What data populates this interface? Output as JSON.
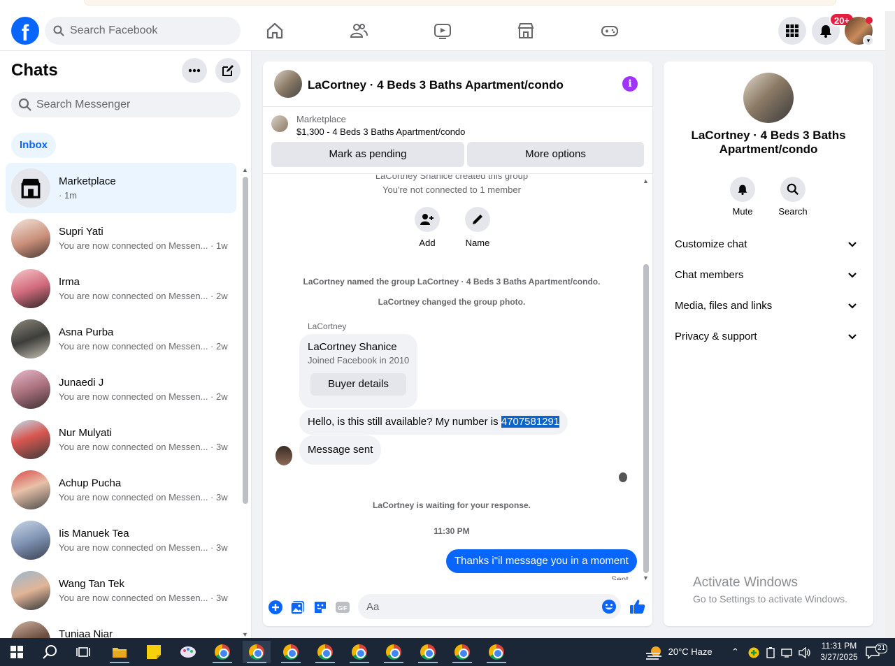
{
  "topnav": {
    "search_placeholder": "Search Facebook",
    "notification_badge": "20+"
  },
  "sidebar": {
    "title": "Chats",
    "search_placeholder": "Search Messenger",
    "filter_label": "Inbox",
    "conversations": [
      {
        "name": "Marketplace",
        "preview": "· 1m"
      },
      {
        "name": "Supri Yati",
        "preview": "You are now connected on Messen... · 1w"
      },
      {
        "name": "Irma",
        "preview": "You are now connected on Messen... · 2w"
      },
      {
        "name": "Asna Purba",
        "preview": "You are now connected on Messen... · 2w"
      },
      {
        "name": "Junaedi J",
        "preview": "You are now connected on Messen... · 2w"
      },
      {
        "name": "Nur Mulyati",
        "preview": "You are now connected on Messen... · 3w"
      },
      {
        "name": "Achup Pucha",
        "preview": "You are now connected on Messen... · 3w"
      },
      {
        "name": "Iis Manuek Tea",
        "preview": "You are now connected on Messen... · 3w"
      },
      {
        "name": "Wang Tan Tek",
        "preview": "You are now connected on Messen... · 3w"
      },
      {
        "name": "Tuniaa Niar",
        "preview": ""
      }
    ]
  },
  "chat": {
    "title": "LaCortney · 4 Beds 3 Baths Apartment/condo",
    "banner": {
      "label": "Marketplace",
      "listing": "$1,300 - 4 Beds 3 Baths Apartment/condo",
      "mark_pending": "Mark as pending",
      "more_options": "More options"
    },
    "system": {
      "created": "LaCortney Shanice created this group",
      "not_connected": "You're not connected to 1 member",
      "named": "LaCortney named the group LaCortney · 4 Beds 3 Baths Apartment/condo.",
      "changed_photo": "LaCortney changed the group photo.",
      "waiting": "LaCortney is waiting for your response.",
      "time": "11:30 PM"
    },
    "actions": {
      "add": "Add",
      "name": "Name"
    },
    "sender_label": "LaCortney",
    "profile_card": {
      "name": "LaCortney Shanice",
      "joined": "Joined Facebook in 2010",
      "button": "Buyer details"
    },
    "messages": {
      "incoming_1_text": "Hello, is this still available? My number is ",
      "incoming_1_highlight": "4707581291",
      "incoming_2": "Message sent",
      "outgoing": "Thanks i\"il message you in a moment",
      "status": "Sent"
    },
    "composer_placeholder": "Aa"
  },
  "details": {
    "title": "LaCortney · 4 Beds 3 Baths Apartment/condo",
    "mute": "Mute",
    "search": "Search",
    "sections": [
      "Customize chat",
      "Chat members",
      "Media, files and links",
      "Privacy & support"
    ]
  },
  "watermark": {
    "title": "Activate Windows",
    "subtitle": "Go to Settings to activate Windows."
  },
  "taskbar": {
    "weather": "20°C  Haze",
    "time": "11:31 PM",
    "date": "3/27/2025",
    "notifications": "21"
  }
}
